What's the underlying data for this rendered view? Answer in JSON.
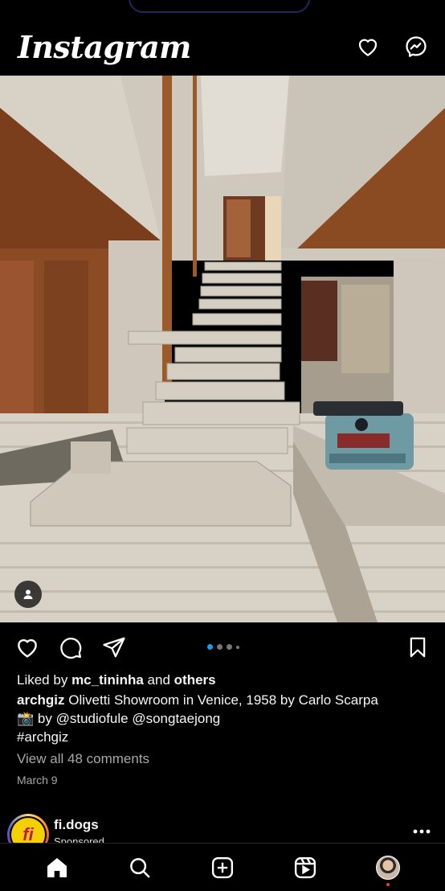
{
  "app": {
    "title": "Instagram"
  },
  "top_bar": {
    "activity_icon": "heart-icon",
    "messages_icon": "messenger-icon"
  },
  "post": {
    "image_alt": "Olivetti Showroom staircase",
    "carousel": {
      "count": 4,
      "active_index": 0
    },
    "likes": {
      "prefix": "Liked by",
      "user": "mc_tininha",
      "connector": "and",
      "others": "others"
    },
    "caption": {
      "username": "archgiz",
      "text": "Olivetti Showroom in Venice, 1958 by Carlo Scarpa",
      "camera_emoji": "📸",
      "credit": "by @studiofule @songtaejong",
      "hashtag": "#archgiz"
    },
    "comments_link": "View all 48 comments",
    "date": "March 9"
  },
  "next_post": {
    "avatar_text": "fi",
    "username": "fi.dogs",
    "subtitle": "Sponsored"
  },
  "bottom_nav": {
    "items": [
      "home-icon",
      "search-icon",
      "create-icon",
      "reels-icon",
      "profile-avatar"
    ]
  },
  "colors": {
    "background": "#000000",
    "text": "#f5f5f5",
    "muted": "#a8a8a8",
    "accent_dot": "#1d9bf0",
    "notification": "#ff3040"
  }
}
